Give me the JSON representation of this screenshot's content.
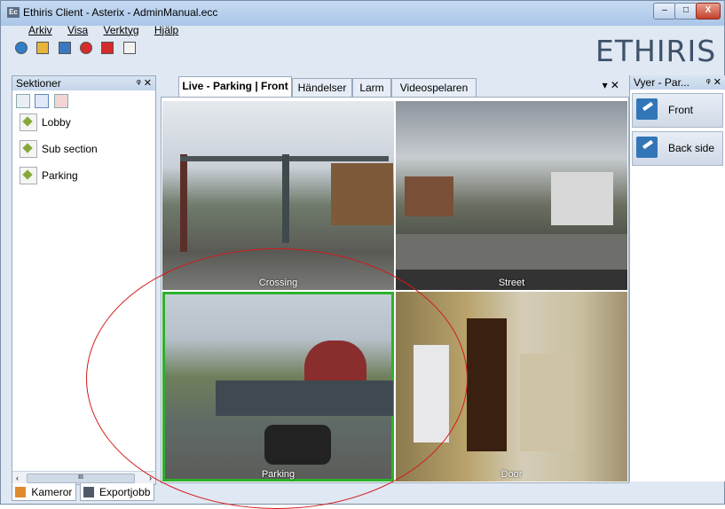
{
  "window": {
    "title": "Ethiris Client - Asterix - AdminManual.ecc",
    "icon_text": "Ec",
    "minimize_label": "–",
    "maximize_label": "□",
    "close_label": "X",
    "brand": "ETHIRIS"
  },
  "menu": [
    "Arkiv",
    "Visa",
    "Verktyg",
    "Hjälp"
  ],
  "toolbar_icons": [
    "settings-icon",
    "folder-icon",
    "sync-icon",
    "record-icon",
    "power-icon",
    "export-icon"
  ],
  "sections_panel": {
    "title": "Sektioner",
    "pin_label": "ᵠ ✕",
    "items": [
      {
        "label": "Lobby"
      },
      {
        "label": "Sub section"
      },
      {
        "label": "Parking"
      }
    ],
    "scroll_thumb": "III",
    "scroll_left": "‹",
    "scroll_right": "›"
  },
  "bottom_tabs": [
    {
      "label": "Kameror"
    },
    {
      "label": "Exportjobb"
    }
  ],
  "center_tabs": [
    {
      "label": "Live - Parking | Front"
    },
    {
      "label": "Händelser"
    },
    {
      "label": "Larm"
    },
    {
      "label": "Videospelaren"
    }
  ],
  "center_tab_controls": "▾ ✕",
  "cameras": [
    {
      "label": "Crossing"
    },
    {
      "label": "Street"
    },
    {
      "label": "Parking",
      "selected": true
    },
    {
      "label": "Door"
    }
  ],
  "views_panel": {
    "title": "Vyer - Par...",
    "pin_label": "ᵠ ✕",
    "items": [
      {
        "label": "Front"
      },
      {
        "label": "Back side"
      }
    ]
  },
  "colors": {
    "selected_camera_border": "#2cb12c",
    "annotation_ellipse": "#d21a1a",
    "brand_text": "#3e5169"
  }
}
